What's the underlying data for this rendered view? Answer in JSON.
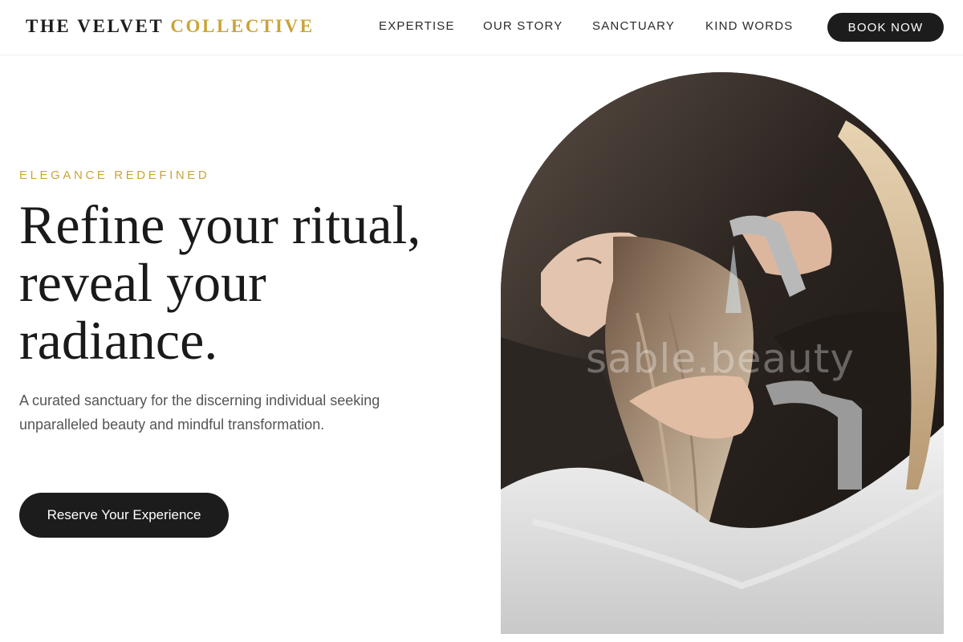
{
  "header": {
    "logo_part1": "THE VELVET",
    "logo_part2": "COLLECTIVE",
    "nav": [
      "EXPERTISE",
      "OUR STORY",
      "SANCTUARY",
      "KIND WORDS"
    ],
    "book_label": "BOOK NOW"
  },
  "hero": {
    "eyebrow": "ELEGANCE REDEFINED",
    "headline_lines": [
      "Refine your ritual,",
      "reveal your",
      "radiance."
    ],
    "subtext": "A curated sanctuary for the discerning individual seeking unparalleled beauty and mindful transformation.",
    "cta_label": "Reserve Your Experience",
    "image_watermark": "sable.beauty"
  },
  "colors": {
    "accent_gold": "#c9a43a",
    "button_dark": "#1c1c1c",
    "text_dark": "#1a1a1a",
    "text_muted": "#555555"
  }
}
